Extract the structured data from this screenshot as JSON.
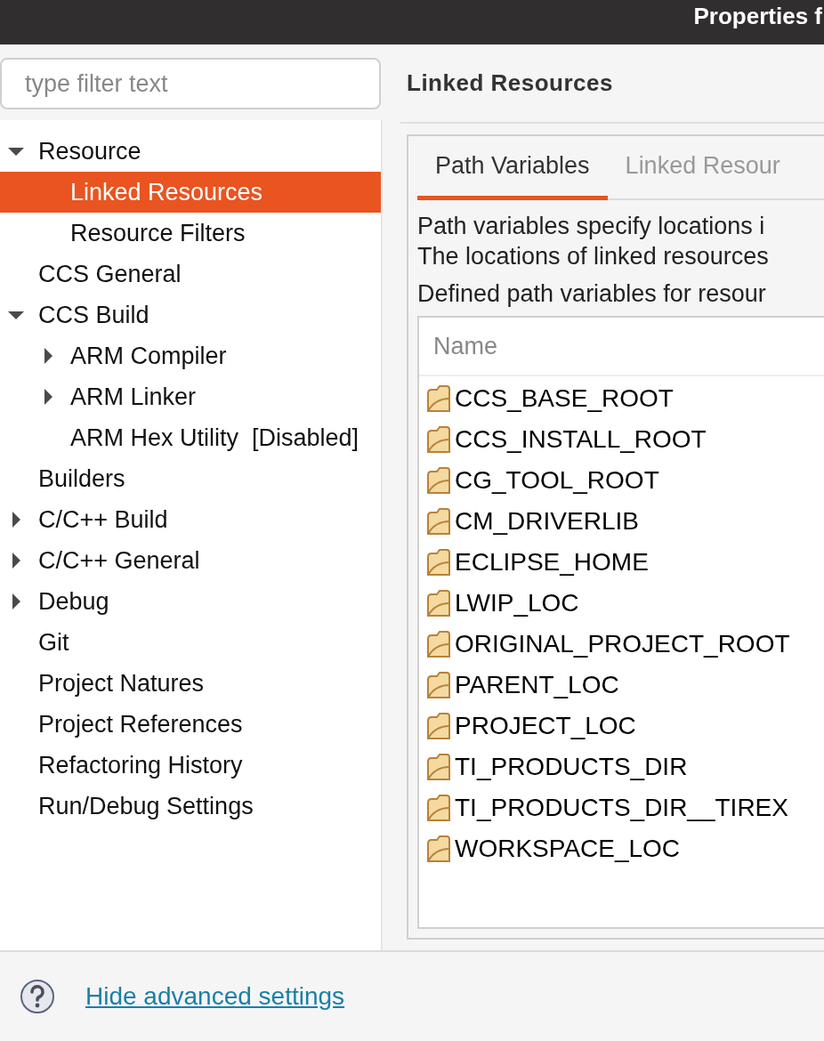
{
  "window": {
    "title": "Properties f"
  },
  "filter": {
    "placeholder": "type filter text"
  },
  "tree": [
    {
      "label": "Resource",
      "expanded": true,
      "selected": false,
      "children": [
        {
          "label": "Linked Resources",
          "selected": true
        },
        {
          "label": "Resource Filters",
          "selected": false
        }
      ]
    },
    {
      "label": "CCS General",
      "selected": false
    },
    {
      "label": "CCS Build",
      "expanded": true,
      "selected": false,
      "children": [
        {
          "label": "ARM Compiler",
          "expanded": false,
          "selected": false
        },
        {
          "label": "ARM Linker",
          "expanded": false,
          "selected": false
        },
        {
          "label": "ARM Hex Utility  [Disabled]",
          "selected": false
        }
      ]
    },
    {
      "label": "Builders",
      "selected": false
    },
    {
      "label": "C/C++ Build",
      "expanded": false,
      "selected": false
    },
    {
      "label": "C/C++ General",
      "expanded": false,
      "selected": false
    },
    {
      "label": "Debug",
      "expanded": false,
      "selected": false
    },
    {
      "label": "Git",
      "selected": false
    },
    {
      "label": "Project Natures",
      "selected": false
    },
    {
      "label": "Project References",
      "selected": false
    },
    {
      "label": "Refactoring History",
      "selected": false
    },
    {
      "label": "Run/Debug Settings",
      "selected": false
    }
  ],
  "page_title": "Linked Resources",
  "tabs": [
    {
      "label": "Path Variables",
      "selected": true
    },
    {
      "label": "Linked Resour",
      "selected": false
    }
  ],
  "description": [
    "Path variables specify locations i",
    "The locations of linked resources"
  ],
  "table_caption": "Defined path variables for resour",
  "table": {
    "columns": [
      "Name"
    ],
    "rows": [
      "CCS_BASE_ROOT",
      "CCS_INSTALL_ROOT",
      "CG_TOOL_ROOT",
      "CM_DRIVERLIB",
      "ECLIPSE_HOME",
      "LWIP_LOC",
      "ORIGINAL_PROJECT_ROOT",
      "PARENT_LOC",
      "PROJECT_LOC",
      "TI_PRODUCTS_DIR",
      "TI_PRODUCTS_DIR__TIREX",
      "WORKSPACE_LOC"
    ]
  },
  "footer": {
    "link": "Hide advanced settings"
  }
}
